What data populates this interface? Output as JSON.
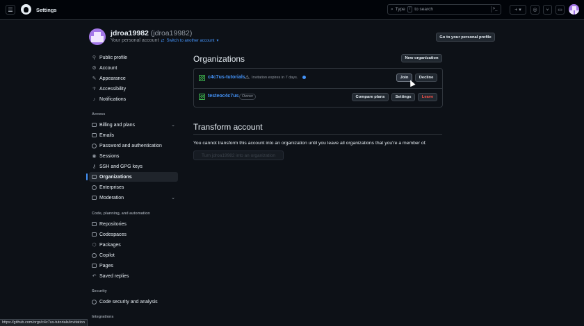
{
  "header": {
    "title": "Settings",
    "search_prefix": "Type",
    "search_key": "/",
    "search_suffix": "to search",
    "command_icon": ">_",
    "plus_label": "+ ▾",
    "issues_icon": "issue-icon",
    "pr_icon": "pull-request-icon",
    "inbox_icon": "inbox-icon"
  },
  "profile": {
    "username": "jdroa19982",
    "login": "(jdroa19982)",
    "account_type": "Your personal account",
    "switch_label": "Switch to another account",
    "go_to_profile": "Go to your personal profile"
  },
  "sidebar": {
    "group1": [
      {
        "label": "Public profile",
        "icon": "person-icon"
      },
      {
        "label": "Account",
        "icon": "gear-icon"
      },
      {
        "label": "Appearance",
        "icon": "paintbrush-icon"
      },
      {
        "label": "Accessibility",
        "icon": "accessibility-icon"
      },
      {
        "label": "Notifications",
        "icon": "bell-icon"
      }
    ],
    "access_heading": "Access",
    "access": [
      {
        "label": "Billing and plans",
        "icon": "credit-card-icon"
      },
      {
        "label": "Emails",
        "icon": "mail-icon"
      },
      {
        "label": "Password and authentication",
        "icon": "shield-lock-icon"
      },
      {
        "label": "Sessions",
        "icon": "broadcast-icon"
      },
      {
        "label": "SSH and GPG keys",
        "icon": "key-icon"
      },
      {
        "label": "Organizations",
        "icon": "organization-icon"
      },
      {
        "label": "Enterprises",
        "icon": "globe-icon"
      },
      {
        "label": "Moderation",
        "icon": "report-icon"
      }
    ],
    "code_heading": "Code, planning, and automation",
    "code": [
      {
        "label": "Repositories",
        "icon": "repo-icon"
      },
      {
        "label": "Codespaces",
        "icon": "codespaces-icon"
      },
      {
        "label": "Packages",
        "icon": "package-icon"
      },
      {
        "label": "Copilot",
        "icon": "copilot-icon"
      },
      {
        "label": "Pages",
        "icon": "browser-icon"
      },
      {
        "label": "Saved replies",
        "icon": "reply-icon"
      }
    ],
    "security_heading": "Security",
    "security": [
      {
        "label": "Code security and analysis",
        "icon": "shield-icon"
      }
    ],
    "integrations_heading": "Integrations"
  },
  "organizations": {
    "title": "Organizations",
    "new_org": "New organization",
    "rows": [
      {
        "name": "c4c7us-tutorials",
        "invite_text": "Invitation expires in 7 days.",
        "join": "Join",
        "decline": "Decline"
      },
      {
        "name": "testeoc4c7us",
        "role": "Owner",
        "compare": "Compare plans",
        "settings": "Settings",
        "leave": "Leave"
      }
    ]
  },
  "transform": {
    "title": "Transform account",
    "description": "You cannot transform this account into an organization until you leave all organizations that you're a member of.",
    "button": "Turn jdroa19982 into an organization"
  },
  "statusbar": {
    "url": "https://github.com/orgs/c4c7us-tutorials/invitation"
  },
  "colors": {
    "background": "#0d1117",
    "header": "#010409",
    "link": "#4493f8",
    "danger": "#f85149",
    "border": "#30363d"
  }
}
